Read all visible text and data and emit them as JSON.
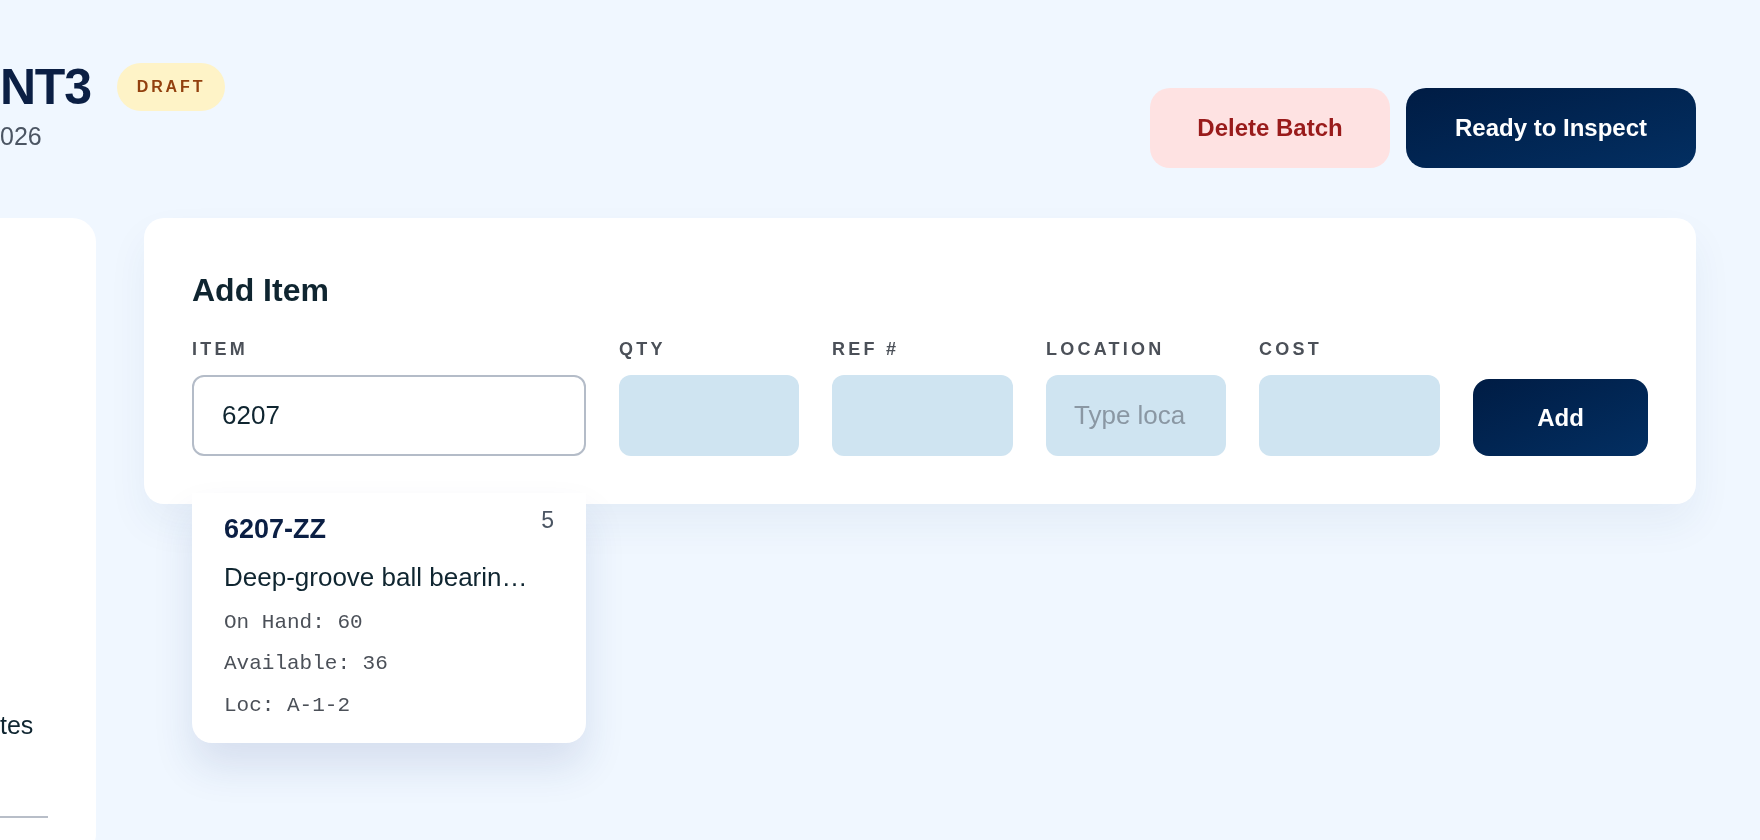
{
  "header": {
    "title": "NT3",
    "status_badge": "DRAFT",
    "date": "026"
  },
  "actions": [
    {
      "label": "Delete Batch",
      "kind": "danger"
    },
    {
      "label": "Ready to Inspect",
      "kind": "primary"
    }
  ],
  "side_panel": {
    "text": "tes"
  },
  "add_item": {
    "title": "Add Item",
    "fields": [
      {
        "label": "ITEM",
        "value": "6207",
        "focused": true
      },
      {
        "label": "QTY",
        "focused": false
      },
      {
        "label": "REF #",
        "focused": false
      },
      {
        "label": "LOCATION",
        "placeholder": "Type loca",
        "focused": false
      },
      {
        "label": "COST",
        "focused": false
      }
    ],
    "button": "Add",
    "suggestions": [
      {
        "code": "6207-ZZ",
        "count": "5",
        "description": "Deep-groove ball bearin…",
        "details": [
          "On Hand: 60",
          "Available: 36",
          "Loc: A-1-2"
        ]
      }
    ]
  }
}
